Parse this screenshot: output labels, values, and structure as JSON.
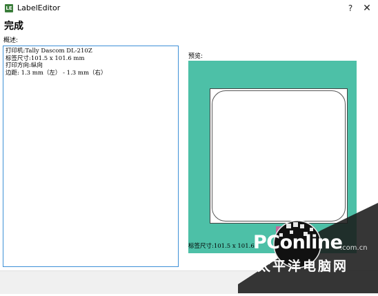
{
  "window": {
    "title": "LabelEditor",
    "help_glyph": "?",
    "close_glyph": "✕",
    "app_icon": "labeleditor-app-icon"
  },
  "page": {
    "heading": "完成"
  },
  "summary": {
    "label": "概述:",
    "lines": [
      "打印机:Tally Dascom DL-210Z",
      "标签尺寸:101.5 x 101.6 mm",
      "打印方向:纵向",
      "边距: 1.3 mm（左） - 1.3 mm（右）"
    ]
  },
  "preview": {
    "label": "预览:",
    "size_text": "标签尺寸:101.5 x 101.6",
    "colors": {
      "background": "#4dc0a7",
      "feed_mark": "#c06a9d"
    }
  },
  "watermark": {
    "brand": "PConline",
    "domain": ".com.cn",
    "chinese": "太平洋电脑网"
  }
}
